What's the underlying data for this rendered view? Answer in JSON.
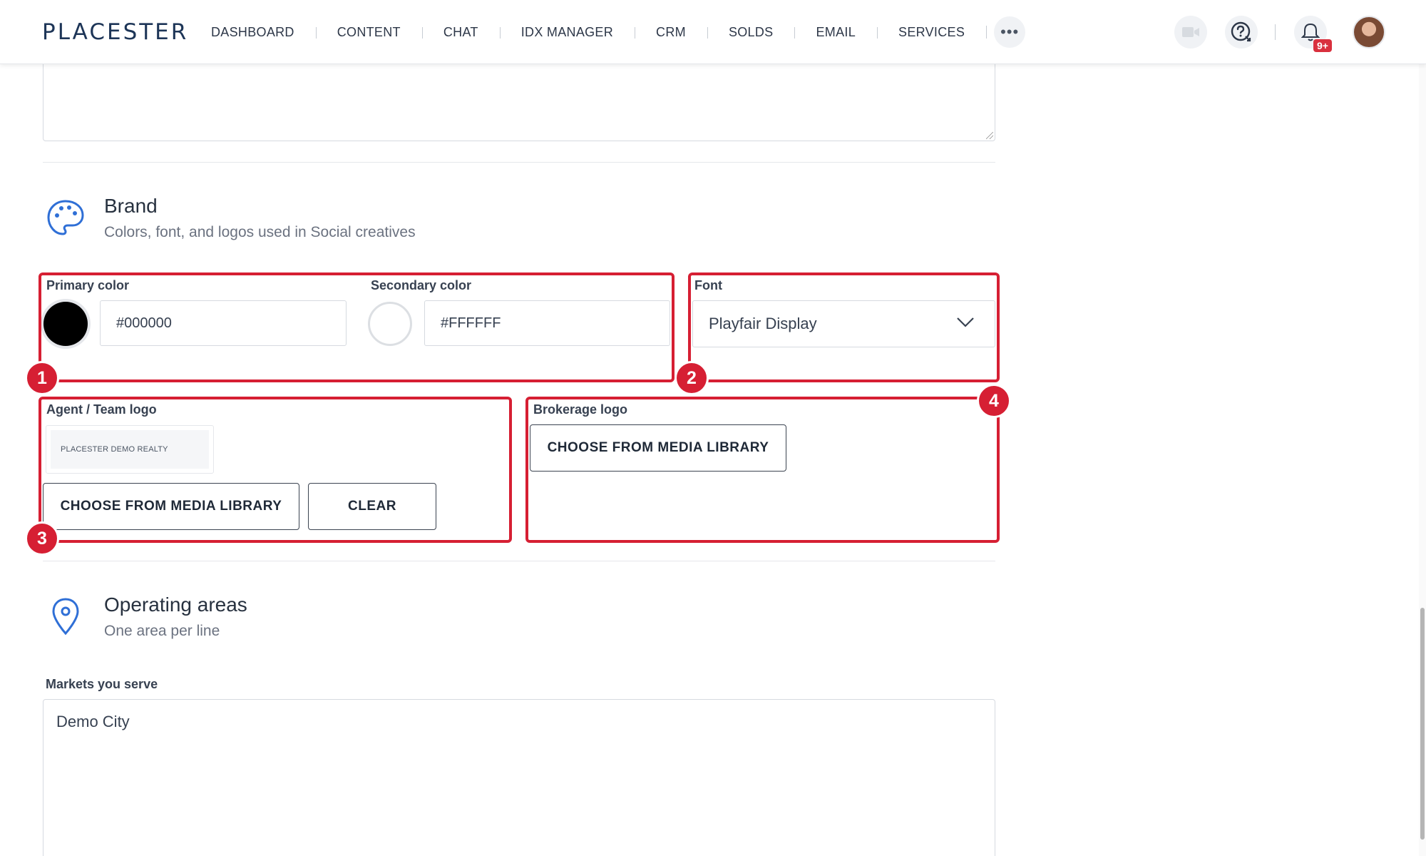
{
  "app": {
    "logo_text": "PLACESTER"
  },
  "nav": {
    "items": [
      "DASHBOARD",
      "CONTENT",
      "CHAT",
      "IDX MANAGER",
      "CRM",
      "SOLDS",
      "EMAIL",
      "SERVICES"
    ],
    "more_label": "•••",
    "notifications_badge": "9+"
  },
  "brand": {
    "title": "Brand",
    "subtitle": "Colors, font, and logos used in Social creatives",
    "primary_color_label": "Primary color",
    "primary_color_value": "#000000",
    "secondary_color_label": "Secondary color",
    "secondary_color_value": "#FFFFFF",
    "font_label": "Font",
    "font_value": "Playfair Display",
    "agent_logo_label": "Agent / Team logo",
    "agent_logo_preview_text": "PLACESTER DEMO REALTY",
    "choose_media_label": "CHOOSE FROM MEDIA LIBRARY",
    "clear_label": "CLEAR",
    "brokerage_logo_label": "Brokerage logo",
    "brokerage_choose_label": "CHOOSE FROM MEDIA LIBRARY"
  },
  "annotations": [
    "1",
    "2",
    "3",
    "4"
  ],
  "operating_areas": {
    "title": "Operating areas",
    "subtitle": "One area per line",
    "markets_label": "Markets you serve",
    "markets_value": "Demo City"
  },
  "colors": {
    "annotation_red": "#d61f33",
    "brand_navy": "#1d3557",
    "icon_blue": "#2f6fd6"
  }
}
